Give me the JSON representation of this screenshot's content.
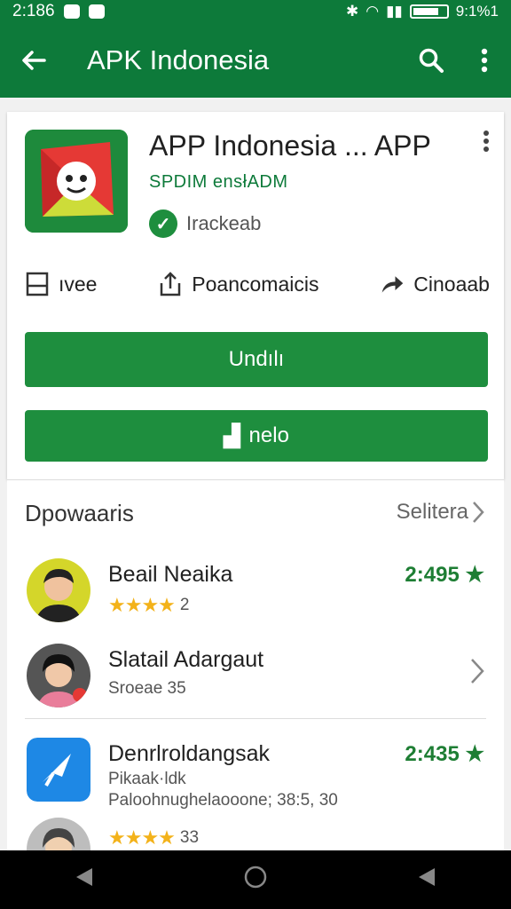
{
  "status": {
    "time": "2:186",
    "right_text": "9:1%1"
  },
  "appbar": {
    "title": "APK Indonesia"
  },
  "app": {
    "title": "APP Indonesia ... APP",
    "developer": "SPDIM ensłADM",
    "badge": "Irackeab",
    "actions": [
      {
        "label": "ıvee",
        "icon": "save-icon"
      },
      {
        "label": "Poancomaicis",
        "icon": "share-icon"
      },
      {
        "label": "Cinoaab",
        "icon": "forward-icon"
      }
    ],
    "primary_button": "Undılı",
    "secondary_button": "nelo"
  },
  "section": {
    "title": "Dpowaaris",
    "more": "Selitera"
  },
  "rows": [
    {
      "name": "Beail Neaika",
      "meta": "2",
      "stars": "★★★★",
      "score": "2:495 ★"
    },
    {
      "name": "Slatail Adargaut",
      "meta": "Sroeae 35"
    },
    {
      "name": "Denrlroldangsak",
      "meta": "Pikaak·ldk",
      "meta2": "Paloohnughelaooone; 38:5, 30",
      "score": "2:435 ★"
    },
    {
      "stars": "★★★★",
      "meta": "33"
    }
  ],
  "colors": {
    "primary": "#0d7a3a",
    "button": "#1e8e3e",
    "star": "#f3b21a"
  }
}
